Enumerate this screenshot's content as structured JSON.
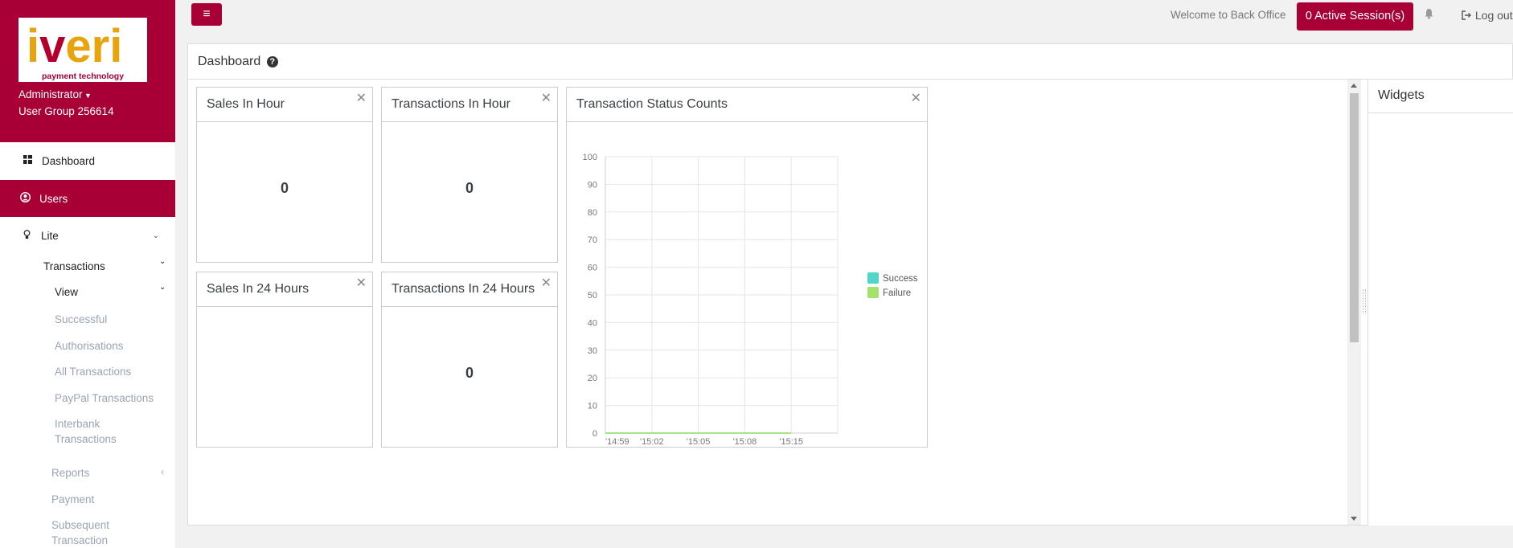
{
  "brand": {
    "logo_text": "iveri",
    "tagline": "payment technology"
  },
  "user": {
    "name": "Administrator",
    "group": "User Group 256614"
  },
  "nav": {
    "dashboard": "Dashboard",
    "users": "Users",
    "lite": "Lite",
    "transactions": "Transactions",
    "view": "View",
    "view_items": [
      "Successful",
      "Authorisations",
      "All Transactions",
      "PayPal Transactions",
      "Interbank",
      "Transactions"
    ],
    "reports": "Reports",
    "payment": "Payment",
    "subsequent": "Subsequent",
    "subsequent2": "Transaction"
  },
  "topbar": {
    "menu_icon": "hamburger-icon",
    "welcome": "Welcome to Back Office",
    "sessions": "0 Active Session(s)",
    "logout": "Log out"
  },
  "dashboard": {
    "title": "Dashboard",
    "widgets": {
      "sales_hour": {
        "title": "Sales In Hour",
        "value": "0"
      },
      "tx_hour": {
        "title": "Transactions In Hour",
        "value": "0"
      },
      "sales_24": {
        "title": "Sales In 24 Hours",
        "value": ""
      },
      "tx_24": {
        "title": "Transactions In 24 Hours",
        "value": "0"
      },
      "status_counts": {
        "title": "Transaction Status Counts"
      }
    }
  },
  "widgets_panel": {
    "title": "Widgets"
  },
  "chart_data": {
    "type": "line",
    "title": "Transaction Status Counts",
    "x": [
      "'14:59",
      "'15:02",
      "'15:05",
      "'15:08",
      "'15:15"
    ],
    "series": [
      {
        "name": "Success",
        "values": [
          0,
          0,
          0,
          0,
          0
        ],
        "color": "#4fd6c9"
      },
      {
        "name": "Failure",
        "values": [
          0,
          0,
          0,
          0,
          0
        ],
        "color": "#a3e36b"
      }
    ],
    "ylim": [
      0,
      100
    ],
    "yticks": [
      0,
      10,
      20,
      30,
      40,
      50,
      60,
      70,
      80,
      90,
      100
    ],
    "grid": true,
    "legend": "right"
  }
}
